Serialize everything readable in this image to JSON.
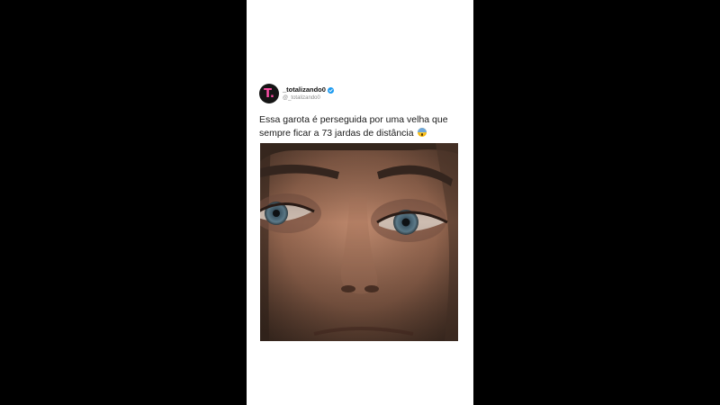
{
  "post": {
    "avatar_initial": "T.",
    "display_name": "_totalizando0",
    "handle": "@_totalizando0",
    "text_line1": "Essa garota é perseguida por uma velha que",
    "text_line2": "sempre ficar a 73 jardas de distância",
    "emoji_icon": "fearful-face-icon",
    "verified_icon": "verified-badge-icon",
    "verified_color": "#1d9bf0",
    "avatar_accent": "#ff4fa8"
  },
  "media": {
    "type": "video-still",
    "subject": "close-up-face"
  }
}
